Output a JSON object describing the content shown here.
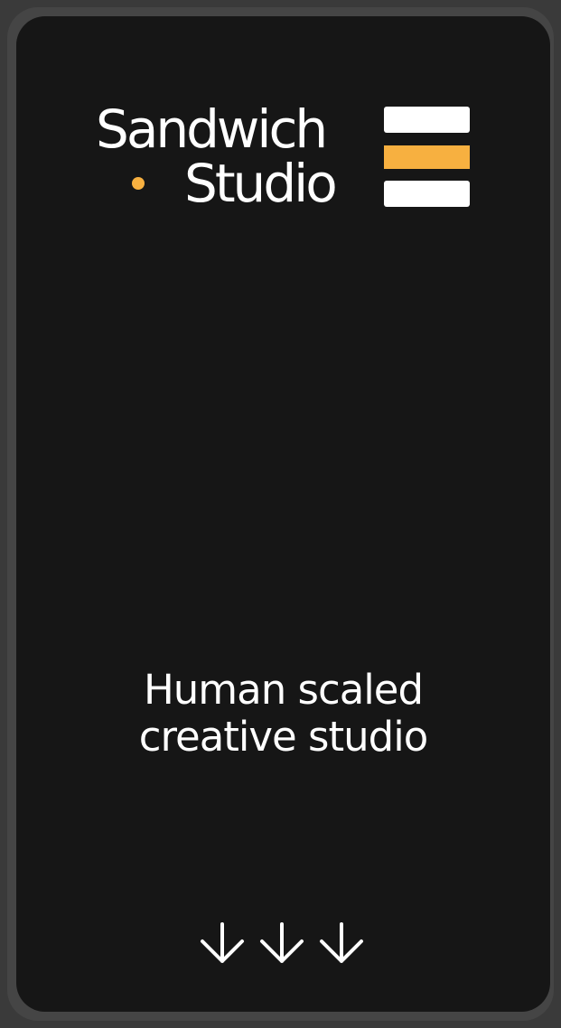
{
  "brand": {
    "line1": "Sandwich",
    "line2": "Studio",
    "accent_color": "#f7b040",
    "text_color": "#ffffff"
  },
  "menu": {
    "icon": "hamburger-menu-icon"
  },
  "hero": {
    "line1": "Human scaled",
    "line2": "creative studio"
  },
  "scroll": {
    "icon": "arrow-down-icon",
    "count": 3
  },
  "colors": {
    "background": "#161616",
    "outer_frame": "#454545"
  }
}
